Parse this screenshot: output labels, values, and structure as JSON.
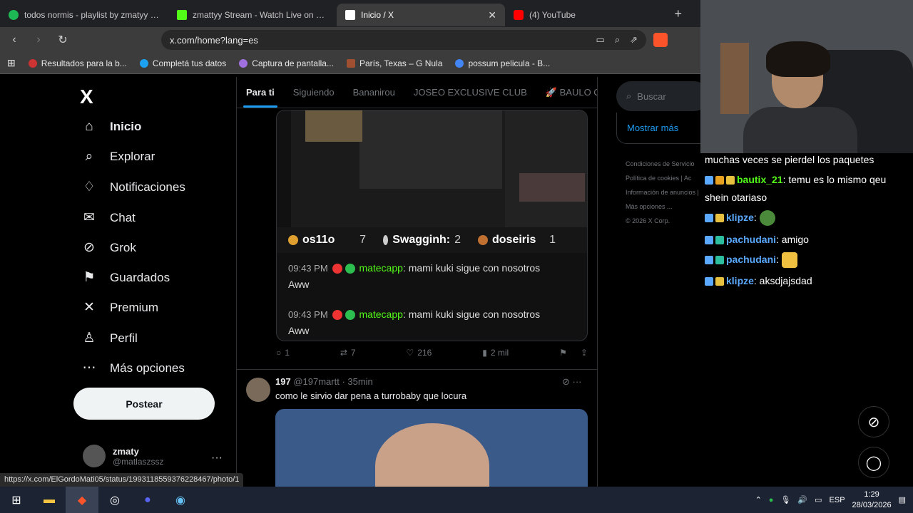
{
  "browser": {
    "tabs": [
      {
        "title": "todos normis - playlist by zmatyy | Sp",
        "color": "#1db954"
      },
      {
        "title": "zmattyy Stream - Watch Live on Kick",
        "color": "#53fc18"
      },
      {
        "title": "Inicio / X",
        "color": "#ffffff",
        "active": true
      },
      {
        "title": "(4) YouTube",
        "color": "#ff0000"
      }
    ],
    "url": "x.com/home?lang=es",
    "bookmarks": [
      "Resultados para la b...",
      "Completá tus datos",
      "Captura de pantalla...",
      "París, Texas – G Nula",
      "possum pelicula - B..."
    ]
  },
  "sidebar": {
    "logo": "X",
    "items": [
      {
        "label": "Inicio",
        "icon": "home-icon",
        "glyph": "⌂"
      },
      {
        "label": "Explorar",
        "icon": "search-icon",
        "glyph": "⌕"
      },
      {
        "label": "Notificaciones",
        "icon": "bell-icon",
        "glyph": "♢"
      },
      {
        "label": "Chat",
        "icon": "mail-icon",
        "glyph": "✉"
      },
      {
        "label": "Grok",
        "icon": "grok-icon",
        "glyph": "⊘"
      },
      {
        "label": "Guardados",
        "icon": "bookmark-icon",
        "glyph": "⚑"
      },
      {
        "label": "Premium",
        "icon": "x-icon",
        "glyph": "✕"
      },
      {
        "label": "Perfil",
        "icon": "person-icon",
        "glyph": "♙"
      },
      {
        "label": "Más opciones",
        "icon": "more-icon",
        "glyph": "⋯"
      }
    ],
    "post_label": "Postear",
    "user_name": "zmaty",
    "user_handle": "@matlaszssz"
  },
  "feed": {
    "tabs": [
      "Para ti",
      "Siguiendo",
      "Bananirou",
      "JOSEO EXCLUSIVE CLUB",
      "🚀 BAULO CL"
    ],
    "board": [
      {
        "name": "os11o",
        "count": "7"
      },
      {
        "name": "Swagginh:",
        "count": "2"
      },
      {
        "name": "doseiris",
        "count": "1"
      }
    ],
    "chat": [
      {
        "time": "09:43 PM",
        "user": "matecapp",
        "msg": ": mami kuki sigue con nosotros",
        "cont": "Aww"
      },
      {
        "time": "09:43 PM",
        "user": "matecapp",
        "msg": ": mami kuki sigue con nosotros",
        "cont": "Aww"
      }
    ],
    "actions": {
      "replies": "1",
      "reposts": "7",
      "likes": "216",
      "views": "2 mil"
    },
    "tweet2": {
      "name": "197",
      "handle": "@197martt · 35min",
      "text": "como le sirvio dar pena a turrobaby que locura"
    }
  },
  "rightcol": {
    "search_placeholder": "Buscar",
    "show_more": "Mostrar más",
    "legal1": "Condiciones de Servicio",
    "legal2": "Política de cookies  |  Ac",
    "legal3": "Información de anuncios  |  Más opciones ...",
    "legal4": "© 2026 X Corp."
  },
  "kick_chat": {
    "lines": [
      {
        "user": "",
        "text": "muchas veces se pierdel los paquetes"
      },
      {
        "user": "bautix_21",
        "text": ": temu es lo mismo qeu",
        "color": "#53fc18"
      },
      {
        "user": "",
        "text": "shein otariaso"
      },
      {
        "user": "klipze",
        "text": ":",
        "color": "#5aa9ff"
      },
      {
        "user": "pachudani",
        "text": ": amigo",
        "color": "#5aa9ff"
      },
      {
        "user": "pachudani",
        "text": ":",
        "color": "#5aa9ff"
      },
      {
        "user": "klipze",
        "text": ": aksdjajsdad",
        "color": "#5aa9ff"
      }
    ]
  },
  "status_url": "https://x.com/ElGordoMati05/status/1993118559376228467/photo/1",
  "taskbar": {
    "lang": "ESP",
    "time": "1:29",
    "date": "28/03/2026"
  }
}
